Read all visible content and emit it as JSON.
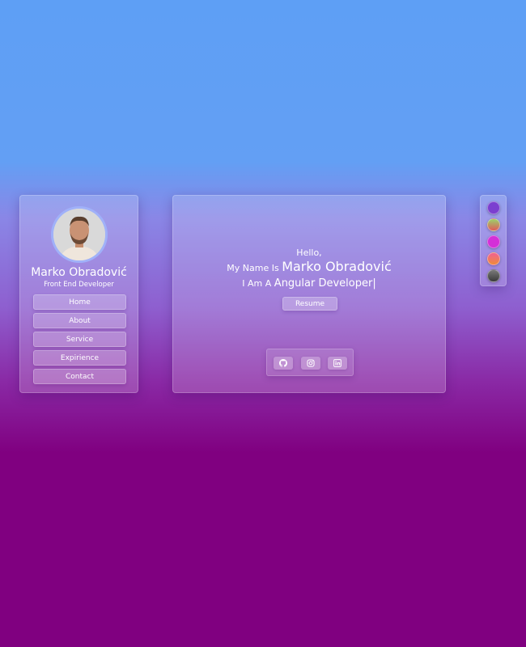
{
  "profile": {
    "name": "Marko Obradović",
    "role": "Front End Developer"
  },
  "nav": {
    "items": [
      "Home",
      "About",
      "Service",
      "Expirience",
      "Contact"
    ]
  },
  "hero": {
    "hello": "Hello,",
    "name_prefix": "My Name Is",
    "name": "Marko Obradović",
    "role_prefix": "I Am A",
    "role": "Angular Developer|",
    "resume_label": "Resume"
  },
  "social": {
    "icons": [
      "github-icon",
      "instagram-icon",
      "linkedin-icon"
    ]
  },
  "themes": {
    "swatches": [
      "#7b3fd0",
      "#8fbf6a",
      "#d42fd8",
      "#e36a8a",
      "#555555"
    ]
  },
  "colors": {
    "background_top": "#5e9ff5",
    "background_bottom": "#800080"
  }
}
